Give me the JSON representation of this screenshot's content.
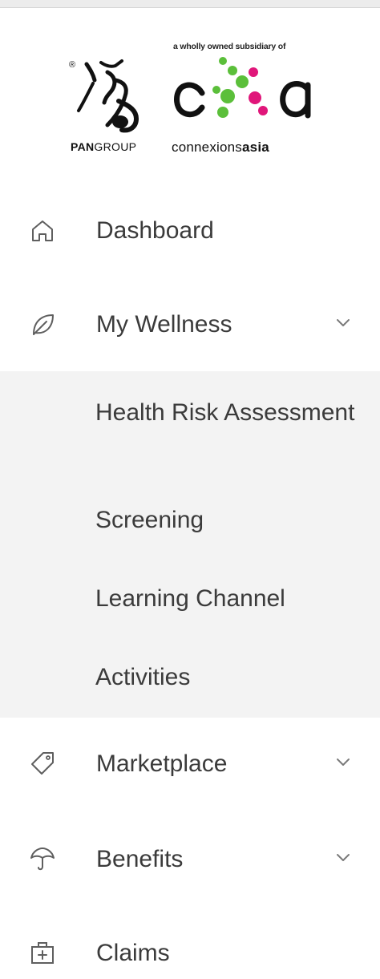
{
  "logo": {
    "pan_brand_bold": "PAN",
    "pan_brand_rest": "GROUP",
    "pan_registered": "®",
    "cxa_tagline": "a wholly owned subsidiary of",
    "cxa_name_regular": "connexions",
    "cxa_name_bold": "asia",
    "colors": {
      "green": "#5bbf3a",
      "magenta": "#e0167a",
      "dark": "#111111"
    }
  },
  "nav": {
    "dashboard": {
      "label": "Dashboard",
      "icon": "home-icon"
    },
    "wellness": {
      "label": "My Wellness",
      "icon": "leaf-icon",
      "expanded": true,
      "items": [
        {
          "label": "Health Risk Assessment"
        },
        {
          "label": "Screening"
        },
        {
          "label": "Learning Channel"
        },
        {
          "label": "Activities"
        }
      ]
    },
    "marketplace": {
      "label": "Marketplace",
      "icon": "tag-icon"
    },
    "benefits": {
      "label": "Benefits",
      "icon": "umbrella-icon"
    },
    "claims": {
      "label": "Claims",
      "icon": "medical-kit-icon"
    }
  },
  "colors": {
    "text": "#3b3b3b",
    "icon": "#5f5f5f",
    "submenu_bg": "#f3f3f3"
  }
}
